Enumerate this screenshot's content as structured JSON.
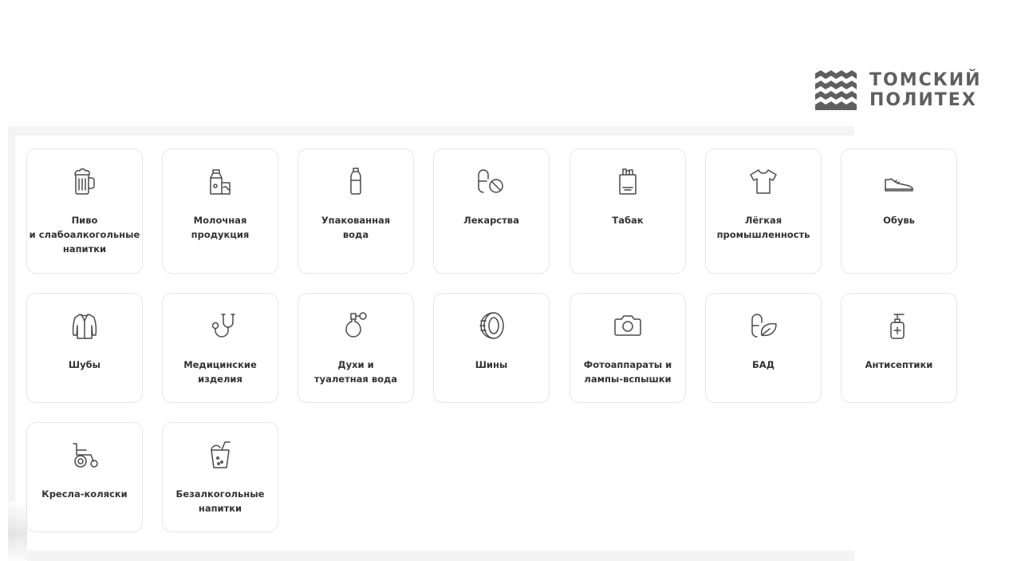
{
  "logo": {
    "line1": "ТОМСКИЙ",
    "line2": "ПОЛИТЕХ",
    "icon": "tpu-logo-icon"
  },
  "categories": [
    {
      "label": "Пиво\nи слабоалкогольные\nнапитки",
      "icon": "beer-mug-icon"
    },
    {
      "label": "Молочная\nпродукция",
      "icon": "milk-carton-icon"
    },
    {
      "label": "Упакованная\nвода",
      "icon": "water-bottle-icon"
    },
    {
      "label": "Лекарства",
      "icon": "pills-icon"
    },
    {
      "label": "Табак",
      "icon": "cigarette-pack-icon"
    },
    {
      "label": "Лёгкая\nпромышленность",
      "icon": "tshirt-icon"
    },
    {
      "label": "Обувь",
      "icon": "sneaker-icon"
    },
    {
      "label": "Шубы",
      "icon": "fur-coat-icon"
    },
    {
      "label": "Медицинские\nизделия",
      "icon": "stethoscope-icon"
    },
    {
      "label": "Духи и\nтуалетная вода",
      "icon": "perfume-bottle-icon"
    },
    {
      "label": "Шины",
      "icon": "tire-icon"
    },
    {
      "label": "Фотоаппараты и\nлампы-вспышки",
      "icon": "camera-icon"
    },
    {
      "label": "БАД",
      "icon": "supplement-leaf-icon"
    },
    {
      "label": "Антисептики",
      "icon": "sanitizer-bottle-icon"
    },
    {
      "label": "Кресла-коляски",
      "icon": "wheelchair-icon"
    },
    {
      "label": "Безалкогольные\nнапитки",
      "icon": "soft-drink-icon"
    }
  ]
}
